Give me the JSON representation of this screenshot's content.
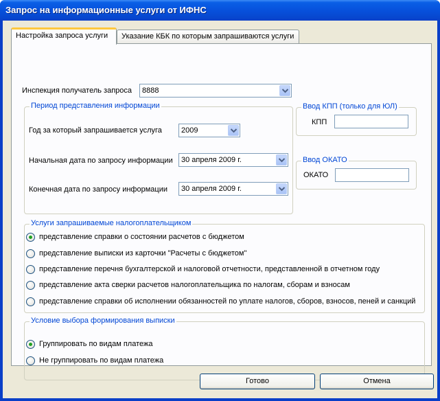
{
  "window": {
    "title": "Запрос на информационные услуги от ИФНС"
  },
  "tabs": [
    {
      "label": "Настройка запроса услуги",
      "active": true
    },
    {
      "label": "Указание КБК по которым запрашиваются услуги",
      "active": false
    }
  ],
  "inspection": {
    "label": "Инспекция получатель запроса",
    "value": "8888"
  },
  "period": {
    "title": "Период представления информации",
    "year_label": "Год за который запрашивается услуга",
    "year_value": "2009",
    "start_label": "Начальная дата по запросу информации",
    "start_value": "30  апреля   2009 г.",
    "end_label": "Конечная дата по запросу информации",
    "end_value": "30  апреля   2009 г."
  },
  "kpp": {
    "title": "Ввод КПП (только для ЮЛ)",
    "label": "КПП",
    "value": ""
  },
  "okato": {
    "title": "Ввод ОКАТО",
    "label": "ОКАТО",
    "value": ""
  },
  "services": {
    "title": "Услуги запрашиваемые налогоплательщиком",
    "options": [
      {
        "label": "представление справки о состоянии расчетов с бюджетом",
        "checked": true
      },
      {
        "label": "представление выписки из карточки \"Расчеты с бюджетом\"",
        "checked": false
      },
      {
        "label": "представление перечня бухгалтерской и налоговой отчетности, представленной в отчетном году",
        "checked": false
      },
      {
        "label": "представление акта сверки расчетов налогоплательщика по налогам, сборам и взносам",
        "checked": false
      },
      {
        "label": "представление справки об исполнении обязанностей по уплате налогов, сборов, взносов, пеней и санкций",
        "checked": false
      }
    ]
  },
  "condition": {
    "title": "Условие выбора формирования выписки",
    "options": [
      {
        "label": "Группировать по видам платежа",
        "checked": true
      },
      {
        "label": "Не группировать по видам платежа",
        "checked": false
      }
    ]
  },
  "buttons": {
    "ok": "Готово",
    "cancel": "Отмена"
  },
  "colors": {
    "titlebar": "#0a5fe6",
    "face": "#ece9d8",
    "group_title": "#0046d5",
    "radio_dot": "#21a121"
  }
}
